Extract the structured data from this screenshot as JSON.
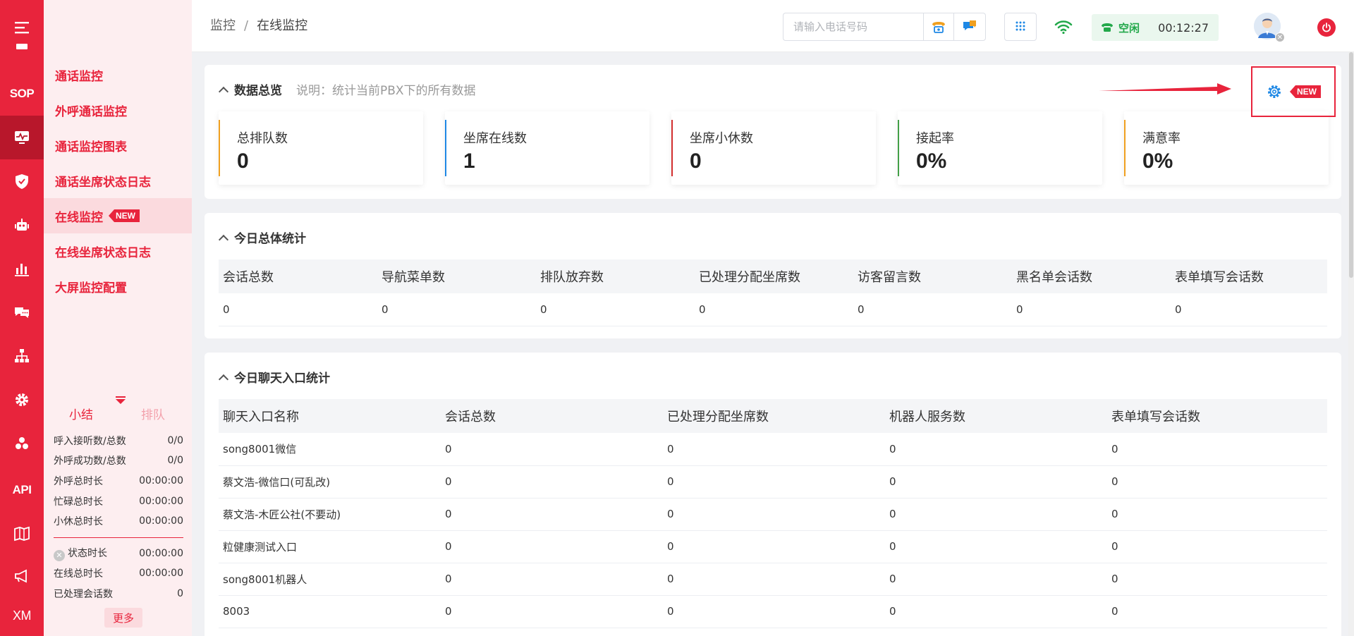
{
  "rail": {
    "sop_label": "SOP",
    "api_label": "API",
    "xm_label": "XM"
  },
  "subnav": {
    "items": [
      {
        "label": "通话监控"
      },
      {
        "label": "外呼通话监控"
      },
      {
        "label": "通话监控图表"
      },
      {
        "label": "通话坐席状态日志"
      },
      {
        "label": "在线监控",
        "badge": "NEW"
      },
      {
        "label": "在线坐席状态日志"
      },
      {
        "label": "大屏监控配置"
      }
    ],
    "summary_tabs": [
      "小结",
      "排队"
    ],
    "stats": [
      {
        "label": "呼入接听数/总数",
        "value": "0/0"
      },
      {
        "label": "外呼成功数/总数",
        "value": "0/0"
      },
      {
        "label": "外呼总时长",
        "value": "00:00:00"
      },
      {
        "label": "忙碌总时长",
        "value": "00:00:00"
      },
      {
        "label": "小休总时长",
        "value": "00:00:00"
      }
    ],
    "stats2": [
      {
        "label": "状态时长",
        "value": "00:00:00"
      },
      {
        "label": "在线总时长",
        "value": "00:00:00"
      },
      {
        "label": "已处理会话数",
        "value": "0"
      }
    ],
    "more_label": "更多"
  },
  "header": {
    "breadcrumb": [
      "监控",
      "在线监控"
    ],
    "phone_placeholder": "请输入电话号码",
    "status_label": "空闲",
    "status_time": "00:12:27"
  },
  "colors": {
    "brand": "#e8243c",
    "kpi_bars": [
      "#f0a020",
      "#1e88e5",
      "#d32f2f",
      "#43a047",
      "#f0a020"
    ]
  },
  "overview": {
    "title": "数据总览",
    "description": "说明：统计当前PBX下的所有数据",
    "new_badge": "NEW",
    "kpis": [
      {
        "label": "总排队数",
        "value": "0"
      },
      {
        "label": "坐席在线数",
        "value": "1"
      },
      {
        "label": "坐席小休数",
        "value": "0"
      },
      {
        "label": "接起率",
        "value": "0%"
      },
      {
        "label": "满意率",
        "value": "0%"
      }
    ]
  },
  "today_stats": {
    "title": "今日总体统计",
    "columns": [
      "会话总数",
      "导航菜单数",
      "排队放弃数",
      "已处理分配坐席数",
      "访客留言数",
      "黑名单会话数",
      "表单填写会话数"
    ],
    "row": [
      "0",
      "0",
      "0",
      "0",
      "0",
      "0",
      "0"
    ]
  },
  "entry_stats": {
    "title": "今日聊天入口统计",
    "columns": [
      "聊天入口名称",
      "会话总数",
      "已处理分配坐席数",
      "机器人服务数",
      "表单填写会话数"
    ],
    "rows": [
      [
        "song8001微信",
        "0",
        "0",
        "0",
        "0"
      ],
      [
        "蔡文浩-微信口(可乱改)",
        "0",
        "0",
        "0",
        "0"
      ],
      [
        "蔡文浩-木匠公社(不要动)",
        "0",
        "0",
        "0",
        "0"
      ],
      [
        "粒健康测试入口",
        "0",
        "0",
        "0",
        "0"
      ],
      [
        "song8001机器人",
        "0",
        "0",
        "0",
        "0"
      ],
      [
        "8003",
        "0",
        "0",
        "0",
        "0"
      ]
    ]
  }
}
